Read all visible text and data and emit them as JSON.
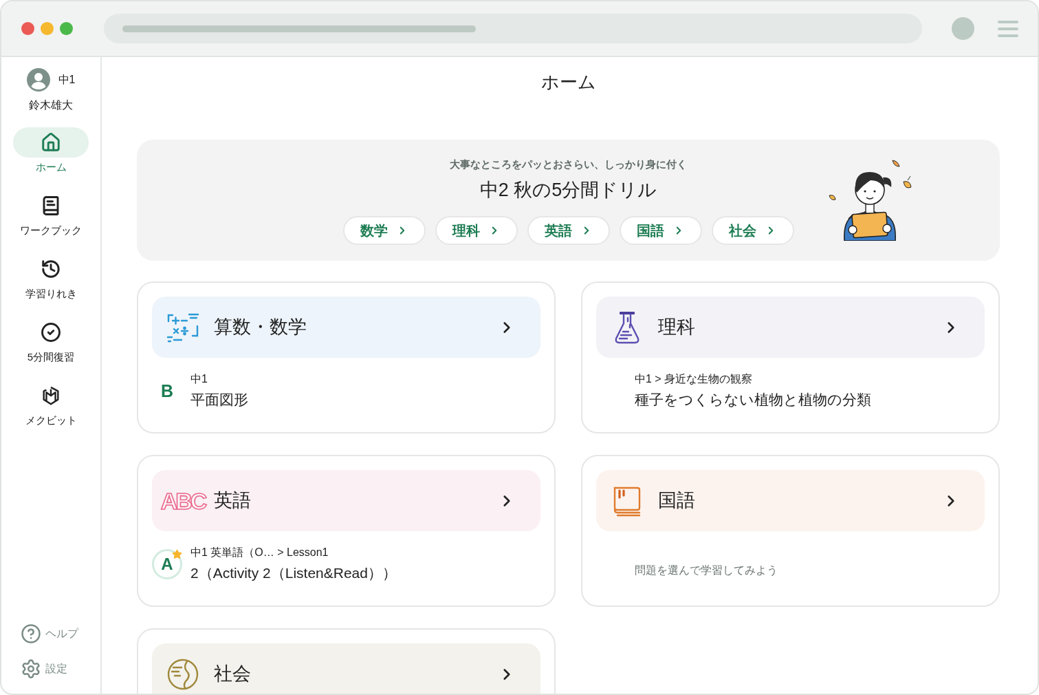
{
  "sidebar": {
    "user": {
      "grade": "中1",
      "name": "鈴木雄大"
    },
    "nav": [
      {
        "label": "ホーム",
        "selected": true
      },
      {
        "label": "ワークブック",
        "selected": false
      },
      {
        "label": "学習りれき",
        "selected": false
      },
      {
        "label": "5分間復習",
        "selected": false
      },
      {
        "label": "メクビット",
        "selected": false
      }
    ],
    "footer": [
      {
        "label": "ヘルプ"
      },
      {
        "label": "設定"
      }
    ]
  },
  "page_title": "ホーム",
  "banner": {
    "subtitle": "大事なところをパッとおさらい、しっかり身に付く",
    "title": "中2 秋の5分間ドリル",
    "subjects": [
      "数学",
      "理科",
      "英語",
      "国語",
      "社会"
    ]
  },
  "subject_cards": [
    {
      "title": "算数・数学",
      "color": "#eef4fb",
      "body": {
        "kind": "progress",
        "badge": {
          "kind": "plain",
          "letter": "B"
        },
        "path": "中1",
        "lesson": "平面図形"
      }
    },
    {
      "title": "理科",
      "color": "#f3f2f7",
      "body": {
        "kind": "progress",
        "path": "中1 > 身近な生物の観察",
        "lesson": "種子をつくらない植物と植物の分類"
      }
    },
    {
      "title": "英語",
      "icon_text": "ABC",
      "color": "#fbf0f3",
      "body": {
        "kind": "progress",
        "badge": {
          "kind": "starred",
          "letter": "A"
        },
        "path": "中1 英単語（O… > Lesson1",
        "lesson": "2（Activity 2（Listen&Read））"
      }
    },
    {
      "title": "国語",
      "color": "#fcf3ee",
      "body": {
        "kind": "empty",
        "message": "問題を選んで学習してみよう"
      }
    },
    {
      "title": "社会",
      "color": "#f3f2ec"
    }
  ]
}
